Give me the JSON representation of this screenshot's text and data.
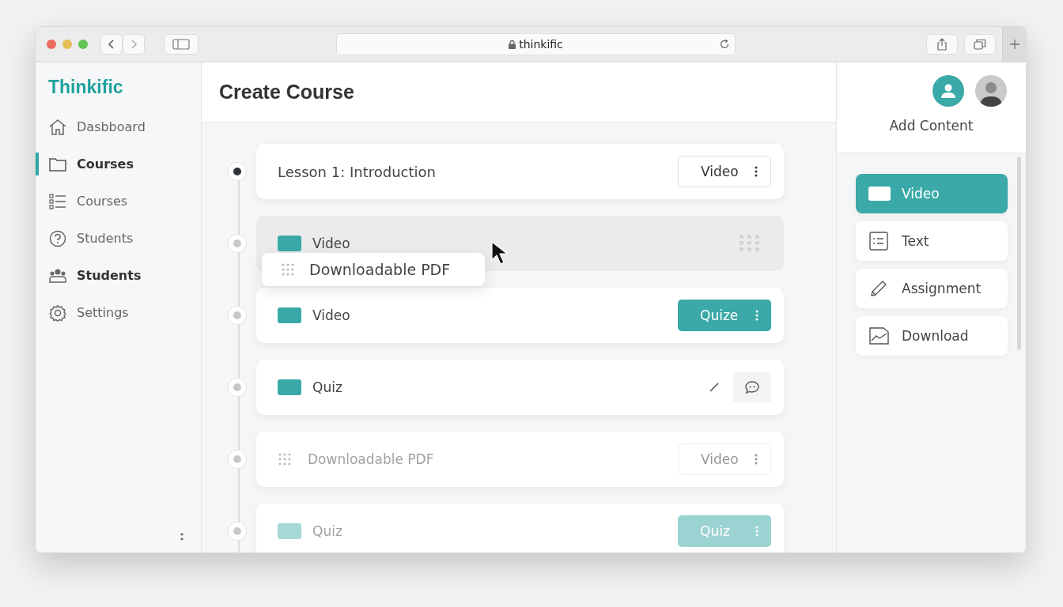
{
  "browser": {
    "url": "thinkific"
  },
  "sidebar": {
    "logo": "Thinkific",
    "items": [
      {
        "label": "Dasbboard",
        "kind": "home",
        "selected": false,
        "bold": false
      },
      {
        "label": "Courses",
        "kind": "folder",
        "selected": true,
        "bold": true
      },
      {
        "label": "Courses",
        "kind": "list",
        "selected": false,
        "bold": false
      },
      {
        "label": "Students",
        "kind": "help",
        "selected": false,
        "bold": false
      },
      {
        "label": "Students",
        "kind": "people",
        "selected": false,
        "bold": true
      },
      {
        "label": "Settings",
        "kind": "gear",
        "selected": false,
        "bold": false
      }
    ]
  },
  "main": {
    "title": "Create Course",
    "rows": [
      {
        "title": "Lesson 1: Introduction",
        "kind": "lesson",
        "current": true,
        "dragging": false,
        "faded": false,
        "action": {
          "kind": "outline",
          "label": "Video"
        }
      },
      {
        "title": "Video",
        "kind": "video",
        "current": false,
        "dragging": true,
        "faded": false,
        "action": {
          "kind": "grip"
        }
      },
      {
        "title": "Video",
        "kind": "video",
        "current": false,
        "dragging": false,
        "faded": false,
        "action": {
          "kind": "filled",
          "label": "Quize"
        }
      },
      {
        "title": "Quiz",
        "kind": "video",
        "current": false,
        "dragging": false,
        "faded": false,
        "action": {
          "kind": "tools"
        }
      },
      {
        "title": "Downloadable PDF",
        "kind": "file",
        "current": false,
        "dragging": false,
        "faded": true,
        "action": {
          "kind": "outline",
          "label": "Video"
        }
      },
      {
        "title": "Quiz",
        "kind": "video",
        "current": false,
        "dragging": false,
        "faded": true,
        "action": {
          "kind": "filled",
          "label": "Quiz"
        }
      }
    ],
    "drag_preview": {
      "title": "Downloadable PDF"
    }
  },
  "panel": {
    "title": "Add Content",
    "items": [
      {
        "label": "Video",
        "kind": "video",
        "selected": true
      },
      {
        "label": "Text",
        "kind": "text",
        "selected": false
      },
      {
        "label": "Assignment",
        "kind": "assignment",
        "selected": false
      },
      {
        "label": "Download",
        "kind": "download",
        "selected": false
      }
    ]
  }
}
